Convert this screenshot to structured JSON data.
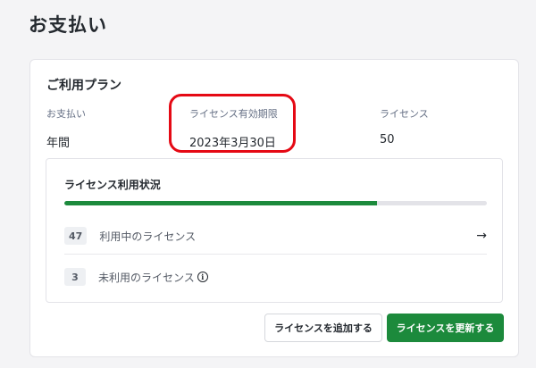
{
  "page": {
    "title": "お支払い"
  },
  "plan": {
    "title": "ご利用プラン",
    "payment_label": "お支払い",
    "payment_value": "年間",
    "expiry_label": "ライセンス有効期限",
    "expiry_value": "2023年3月30日",
    "license_label": "ライセンス",
    "license_value": "50"
  },
  "usage": {
    "title": "ライセンス利用状況",
    "used_fraction": 0.74,
    "used_count": "47",
    "used_label": "利用中のライセンス",
    "unused_count": "3",
    "unused_label": "未利用のライセンス",
    "arrow_icon": "→",
    "info_icon": "i"
  },
  "actions": {
    "add_label": "ライセンスを追加する",
    "renew_label": "ライセンスを更新する"
  },
  "colors": {
    "accent": "#1c8a3c",
    "highlight": "#e50914"
  }
}
